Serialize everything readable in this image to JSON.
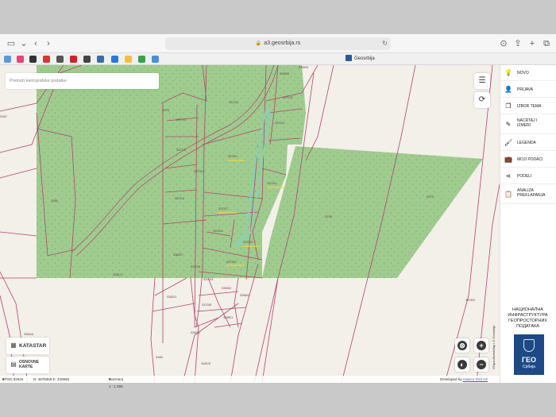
{
  "browser": {
    "url": "a3.geosrbija.rs",
    "tab_title": "Geosrbija"
  },
  "search": {
    "placeholder": "Pretraži kartografske podatke"
  },
  "sidebar": {
    "items": [
      {
        "label": "NOVO",
        "icon": "lightbulb-icon"
      },
      {
        "label": "PRIJAVA",
        "icon": "user-icon"
      },
      {
        "label": "IZBOR TEMA",
        "icon": "copy-icon"
      },
      {
        "label": "NACRTAJ I IZMERI",
        "icon": "pencil-icon"
      },
      {
        "label": "LEGENDA",
        "icon": "brush-icon"
      },
      {
        "label": "MOJI PODACI",
        "icon": "briefcase-icon"
      },
      {
        "label": "PODELI",
        "icon": "share-icon"
      },
      {
        "label": "ANALIZA PREKLAPANJA",
        "icon": "clipboard-icon"
      }
    ],
    "org_name": "НАЦИОНАЛНА ИНФРАСТРУКТУРА ГЕОПРОСТОРНИХ ПОДАТАКА",
    "logo_title": "ГЕО",
    "logo_subtitle": "Србија"
  },
  "layers": {
    "katastar": "KATASTAR",
    "osnovne_karte": "OSNOVNE KARTE"
  },
  "status": {
    "crs": "EPSG:32634",
    "coordinates": "N: 4878369 E: 420555",
    "scale": "Razmera 1 : 1 250",
    "credit_vertical": "©OpenStreetMap i © Geosrbija",
    "developed_by": "Developed by",
    "developer_link": "Asseco Vizit AS"
  },
  "parcels": [
    "3369/3",
    "3369/5",
    "3372/2",
    "3372/3",
    "3372/4",
    "3377/3",
    "3375",
    "3376/1",
    "3371/3",
    "3374/1",
    "3373/1",
    "3373/7",
    "3371/2",
    "3373/4",
    "3373/5",
    "3373/3",
    "3378",
    "3379",
    "3380",
    "3367",
    "3381/1",
    "3369/7",
    "3373/6",
    "3370/3",
    "3369/2",
    "3366/2",
    "3382/1",
    "3370/5",
    "3385/1",
    "3360",
    "3381/5",
    "3376/2",
    "3384/4",
    "3363/1"
  ],
  "colors": {
    "forest": "#9fcb8f",
    "background": "#f3efe9",
    "parcel_line": "#b0456c",
    "highlight": "#7fd3c8",
    "logo_blue": "#1d4a86"
  }
}
